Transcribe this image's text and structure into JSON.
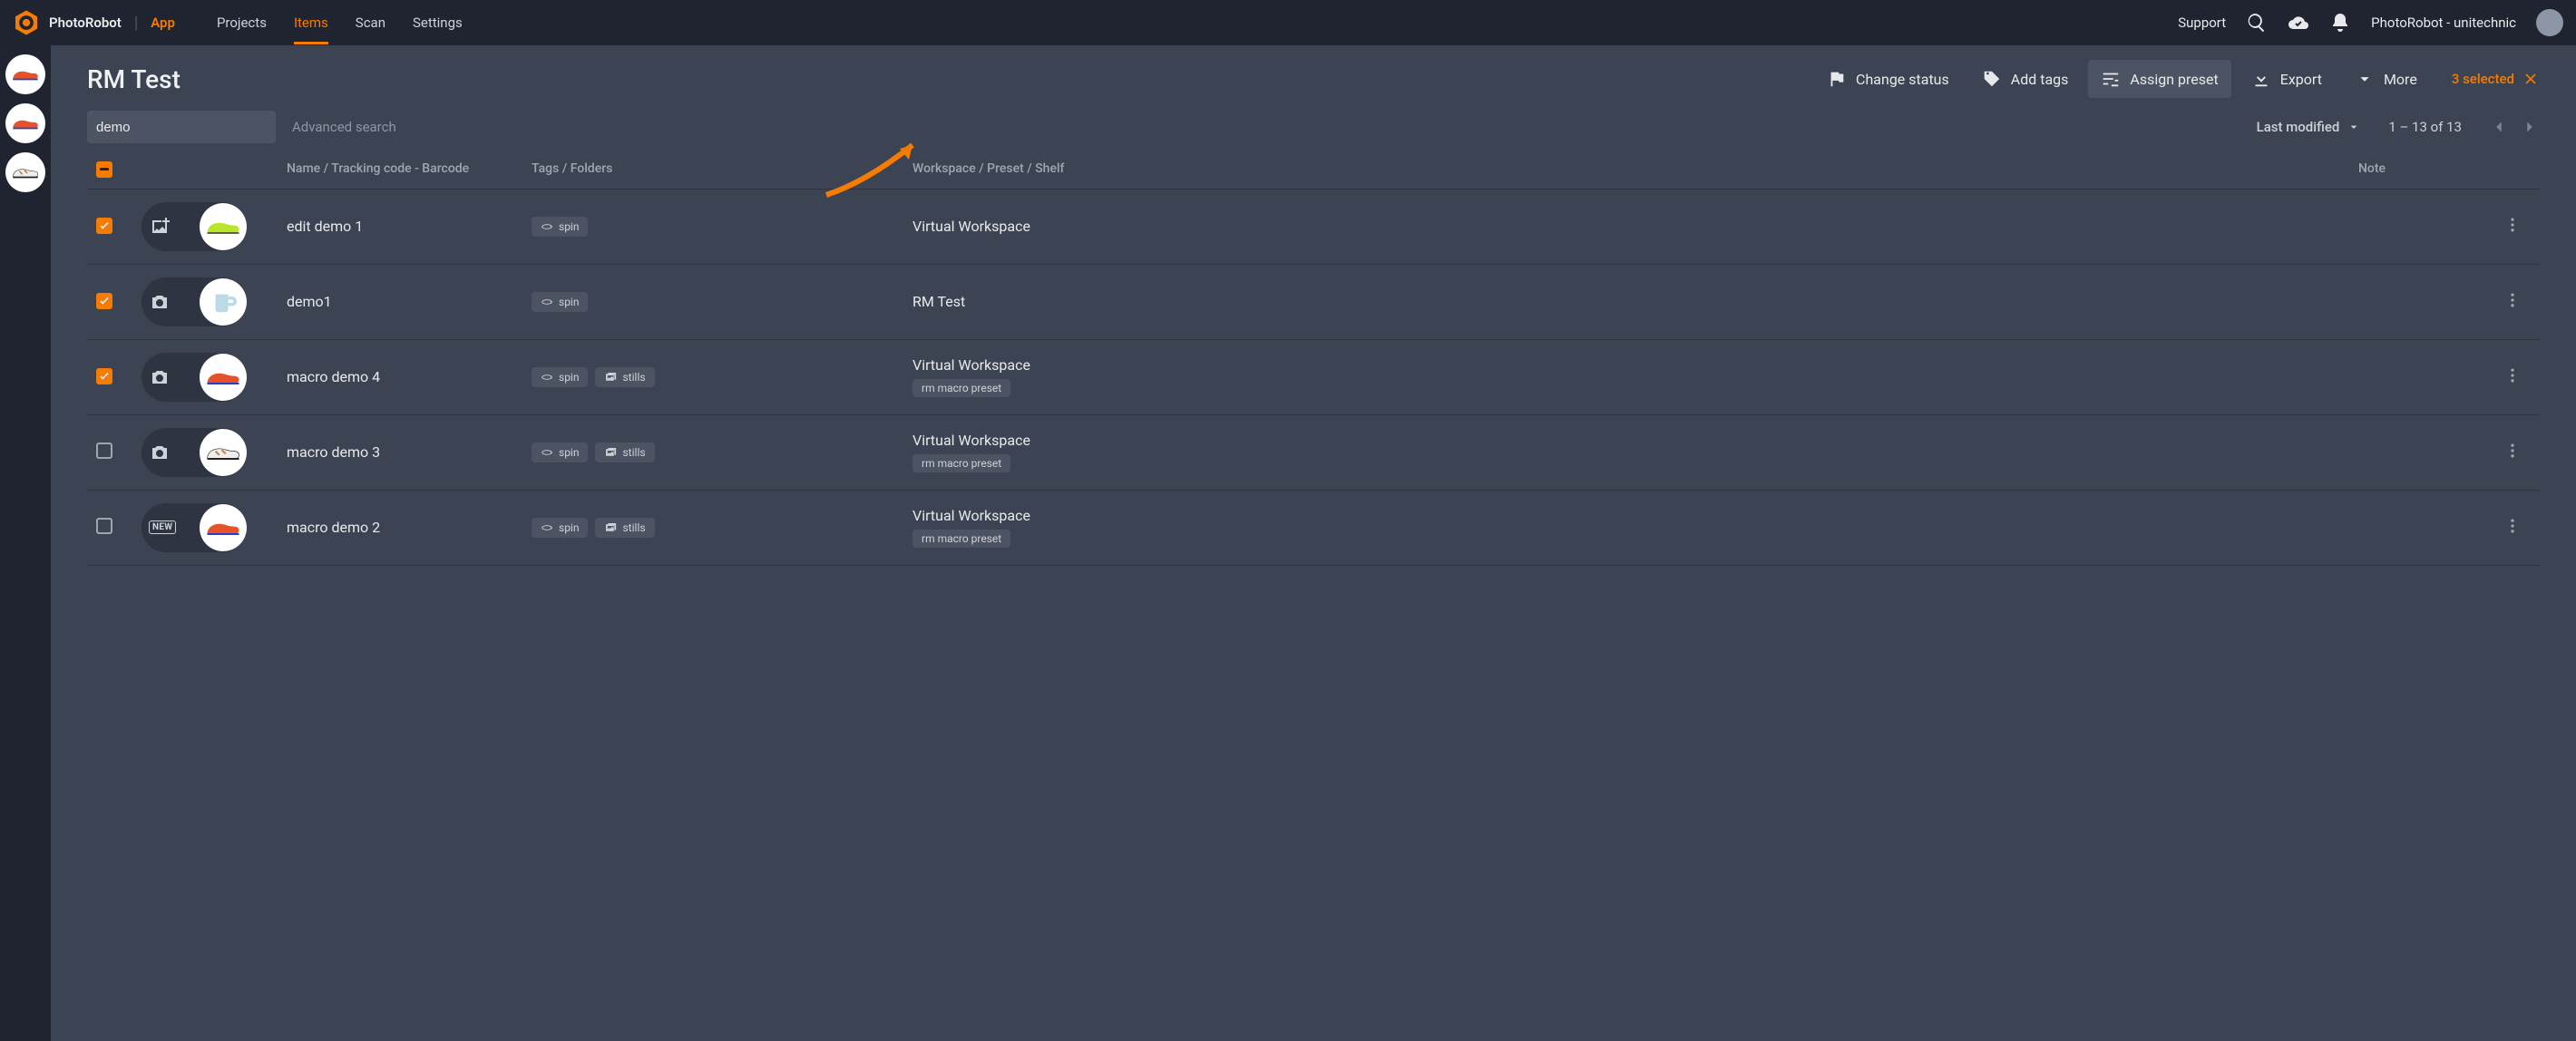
{
  "brand": {
    "name": "PhotoRobot",
    "app_label": "App"
  },
  "nav": {
    "projects": "Projects",
    "items": "Items",
    "scan": "Scan",
    "settings": "Settings",
    "active": "items"
  },
  "top_right": {
    "support": "Support",
    "username": "PhotoRobot - unitechnic"
  },
  "sidebar_thumbs": [
    {
      "variant": "shoe-orange"
    },
    {
      "variant": "shoe-orange"
    },
    {
      "variant": "shoe-white"
    }
  ],
  "page": {
    "title": "RM Test",
    "selected_count": "3 selected"
  },
  "actions": {
    "change_status": "Change status",
    "add_tags": "Add tags",
    "assign_preset": "Assign preset",
    "export": "Export",
    "more": "More"
  },
  "search": {
    "value": "demo",
    "advanced": "Advanced search"
  },
  "sort": {
    "label": "Last modified",
    "range": "1 – 13 of 13"
  },
  "columns": {
    "name": "Name / Tracking code - Barcode",
    "tags": "Tags / Folders",
    "workspace": "Workspace / Preset / Shelf",
    "note": "Note"
  },
  "tags": {
    "spin": "spin",
    "stills": "stills"
  },
  "rows": [
    {
      "checked": true,
      "status_icon": "add-photo",
      "thumb": "shoe-green",
      "name": "edit demo 1",
      "tags": [
        "spin"
      ],
      "workspace": "Virtual Workspace",
      "preset": null
    },
    {
      "checked": true,
      "status_icon": "camera",
      "thumb": "mug",
      "name": "demo1",
      "tags": [
        "spin"
      ],
      "workspace": "RM Test",
      "preset": null
    },
    {
      "checked": true,
      "status_icon": "camera",
      "thumb": "shoe-orange",
      "name": "macro demo 4",
      "tags": [
        "spin",
        "stills"
      ],
      "workspace": "Virtual Workspace",
      "preset": "rm macro preset"
    },
    {
      "checked": false,
      "status_icon": "camera",
      "thumb": "shoe-white",
      "name": "macro demo 3",
      "tags": [
        "spin",
        "stills"
      ],
      "workspace": "Virtual Workspace",
      "preset": "rm macro preset"
    },
    {
      "checked": false,
      "status_icon": "new",
      "thumb": "shoe-orange",
      "name": "macro demo 2",
      "tags": [
        "spin",
        "stills"
      ],
      "workspace": "Virtual Workspace",
      "preset": "rm macro preset"
    }
  ]
}
